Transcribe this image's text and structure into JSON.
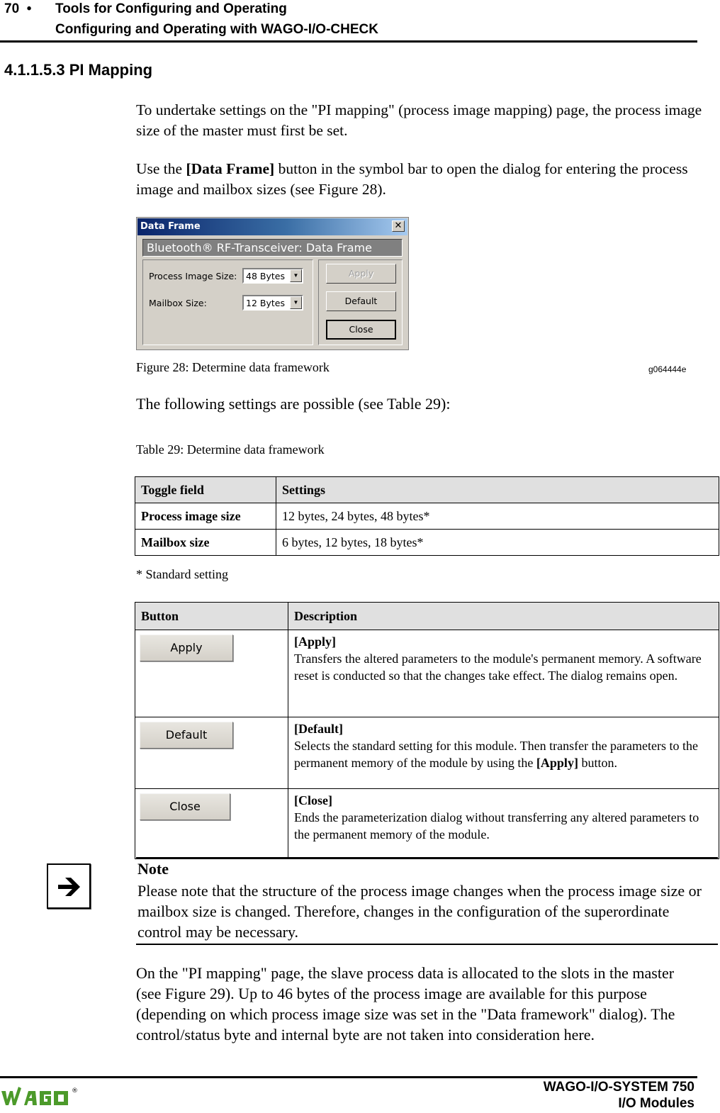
{
  "header": {
    "page_number": "70",
    "bullet": "•",
    "chapter_title": "Tools for Configuring and Operating",
    "section_title": "Configuring and Operating with WAGO-I/O-CHECK"
  },
  "section": {
    "number_title": "4.1.1.5.3 PI Mapping"
  },
  "paragraphs": {
    "p1": "To undertake settings on the \"PI mapping\" (process image mapping) page, the process image size of the master must first be set.",
    "p2_before": "Use the ",
    "p2_bold": "[Data Frame]",
    "p2_after": " button in the symbol bar to open the dialog for entering the process image and mailbox sizes (see Figure 28).",
    "p3": "The following settings are possible (see Table 29):",
    "p4": "On the \"PI mapping\" page, the slave process data is allocated to the slots in the master (see Figure 29). Up to 46 bytes of the process image are available for this purpose (depending on which process image size was set in the \"Data framework\" dialog). The control/status byte and internal byte are not taken into consideration here."
  },
  "dialog": {
    "title": "Data Frame",
    "close_glyph": "✕",
    "banner": "Bluetooth® RF-Transceiver: Data Frame",
    "fields": [
      {
        "label": "Process Image Size:",
        "value": "48 Bytes"
      },
      {
        "label": "Mailbox Size:",
        "value": "12 Bytes"
      }
    ],
    "dropdown_glyph": "▼",
    "buttons": {
      "apply": "Apply",
      "default": "Default",
      "close": "Close"
    }
  },
  "figure": {
    "caption": "Figure 28: Determine data framework",
    "id": "g064444e"
  },
  "table1": {
    "caption": "Table 29: Determine data framework",
    "headers": [
      "Toggle field",
      "Settings"
    ],
    "rows": [
      [
        "Process image size",
        "12 bytes, 24 bytes, 48 bytes*"
      ],
      [
        "Mailbox size",
        "6 bytes, 12 bytes, 18 bytes*"
      ]
    ],
    "footnote": "* Standard setting"
  },
  "table2": {
    "headers": [
      "Button",
      "Description"
    ],
    "rows": [
      {
        "button": "Apply",
        "title": "[Apply]",
        "text": "Transfers the altered parameters to the module's permanent memory. A software reset is conducted so that the changes take effect. The dialog remains open."
      },
      {
        "button": "Default",
        "title": "[Default]",
        "text_before": "Selects the standard setting for this module. Then transfer the parameters to the permanent memory of the module by using the ",
        "text_bold": "[Apply]",
        "text_after": " button."
      },
      {
        "button": "Close",
        "title": "[Close]",
        "text": "Ends the parameterization dialog without transferring any altered parameters to the permanent memory of the module."
      }
    ]
  },
  "note": {
    "icon": "arrow-right-icon",
    "title": "Note",
    "text": "Please note that the structure of the process image changes when the process image size or mailbox size is changed. Therefore, changes in the configuration of the superordinate control may be necessary."
  },
  "footer": {
    "logo": "WAGO",
    "registered": "®",
    "brand_color": "#4c9a2a",
    "line1": "WAGO-I/O-SYSTEM 750",
    "line2": "I/O Modules"
  }
}
